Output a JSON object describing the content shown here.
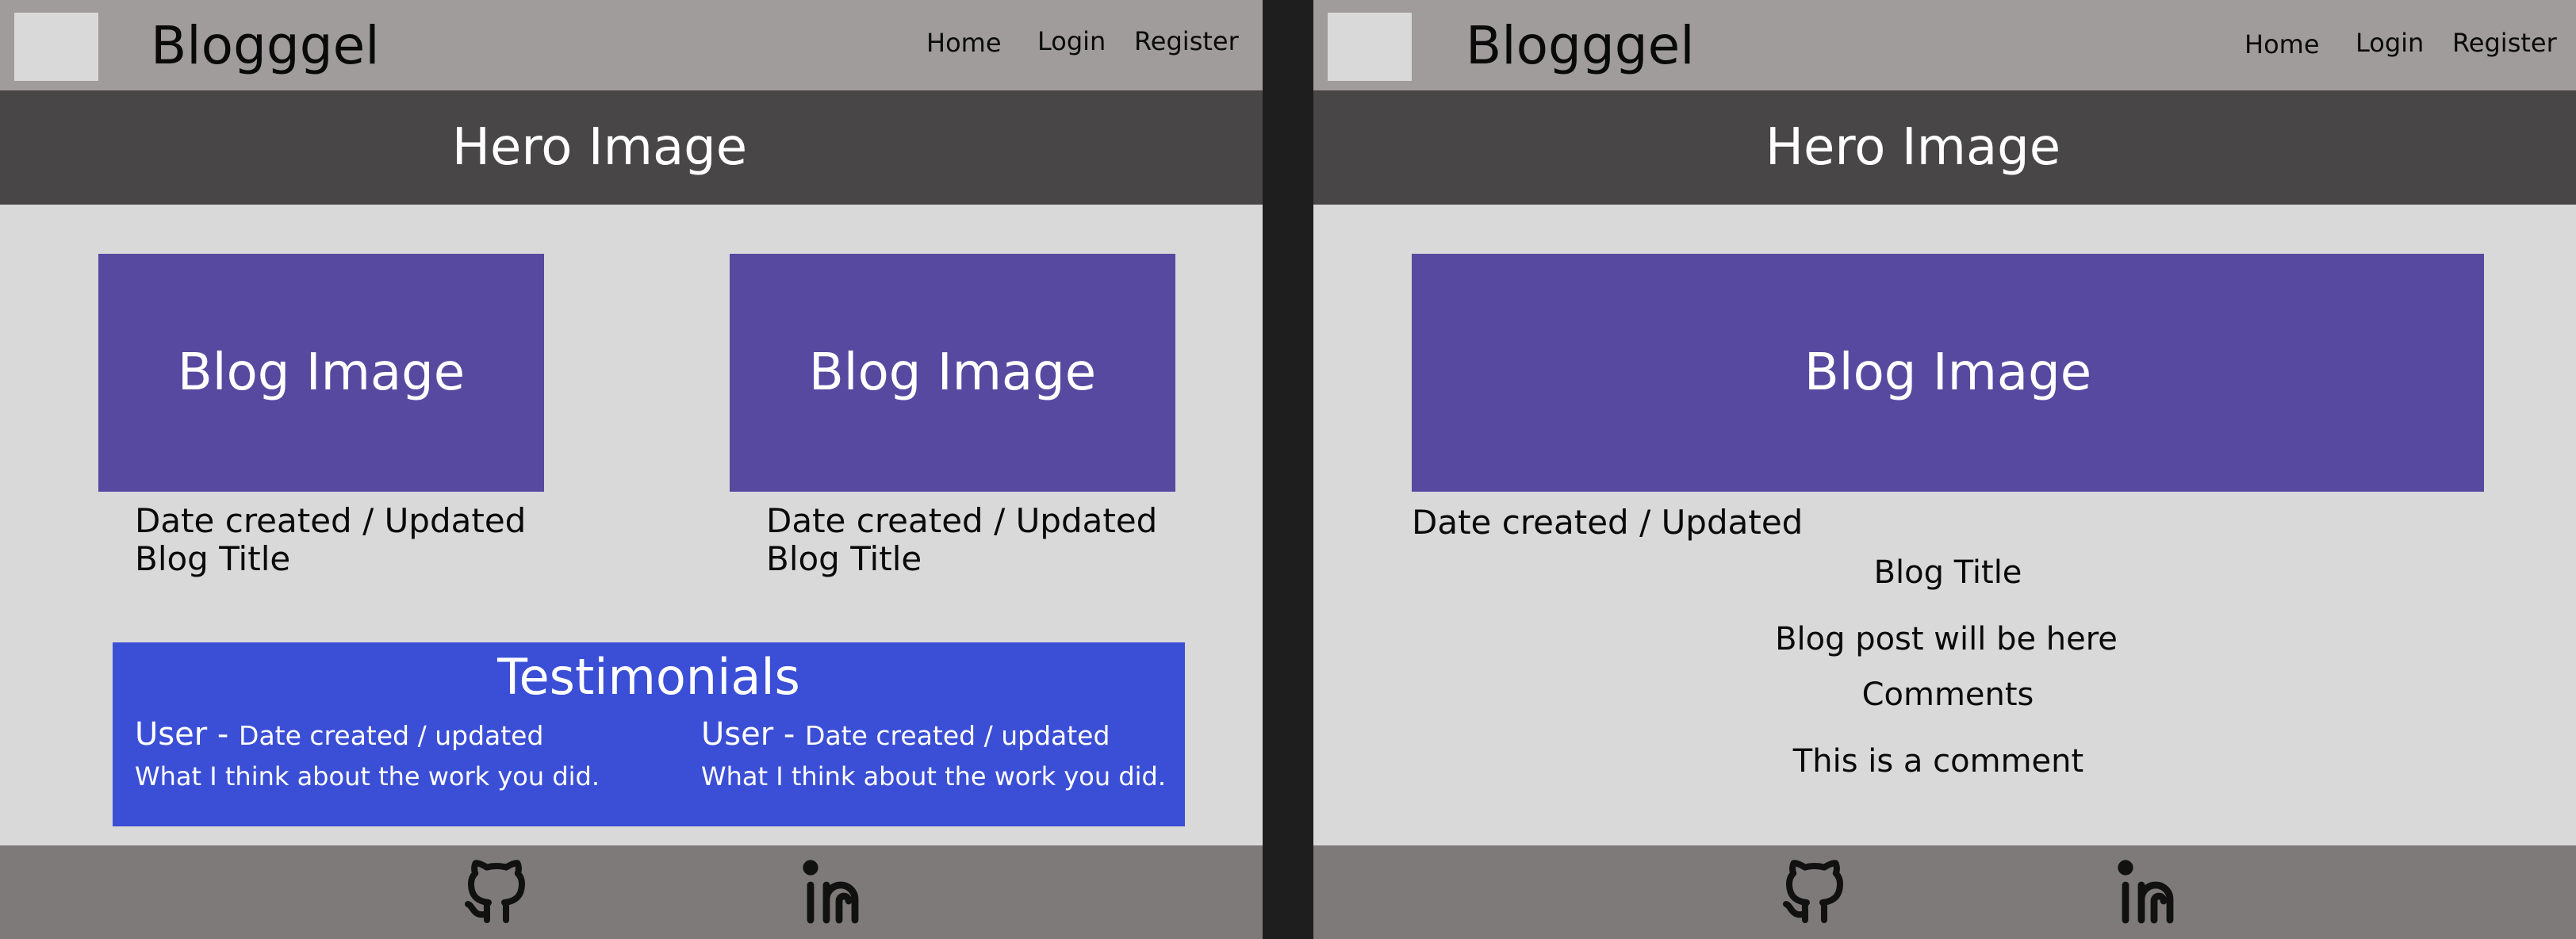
{
  "left": {
    "nav": {
      "brand": "Blogggel",
      "links": [
        "Home",
        "Login",
        "Register"
      ]
    },
    "hero": "Hero Image",
    "cards": [
      {
        "image": "Blog Image",
        "date": "Date created / Updated",
        "title": "Blog Title"
      },
      {
        "image": "Blog Image",
        "date": "Date created / Updated",
        "title": "Blog Title"
      }
    ],
    "testimonials": {
      "heading": "Testimonials",
      "items": [
        {
          "user": "User - ",
          "date": "Date created / updated",
          "text": "What I think about the work you did."
        },
        {
          "user": "User - ",
          "date": "Date created / updated",
          "text": "What I think about the work you did."
        }
      ]
    },
    "footer": {
      "icons": [
        "github-icon",
        "linkedin-icon"
      ]
    }
  },
  "right": {
    "nav": {
      "brand": "Blogggel",
      "links": [
        "Home",
        "Login",
        "Register"
      ]
    },
    "hero": "Hero Image",
    "post": {
      "image": "Blog Image",
      "date": "Date created / Updated",
      "title": "Blog Title",
      "body": "Blog post will be here",
      "comments_heading": "Comments",
      "comment": "This is a comment"
    },
    "footer": {
      "icons": [
        "github-icon",
        "linkedin-icon"
      ]
    }
  },
  "colors": {
    "nav": "#a09c9b",
    "hero": "#484646",
    "page": "#d9d9d9",
    "blog_image": "#5749a0",
    "testimonials": "#3b4fd6",
    "footer": "#7d7a79",
    "divider": "#1e1e1e"
  }
}
